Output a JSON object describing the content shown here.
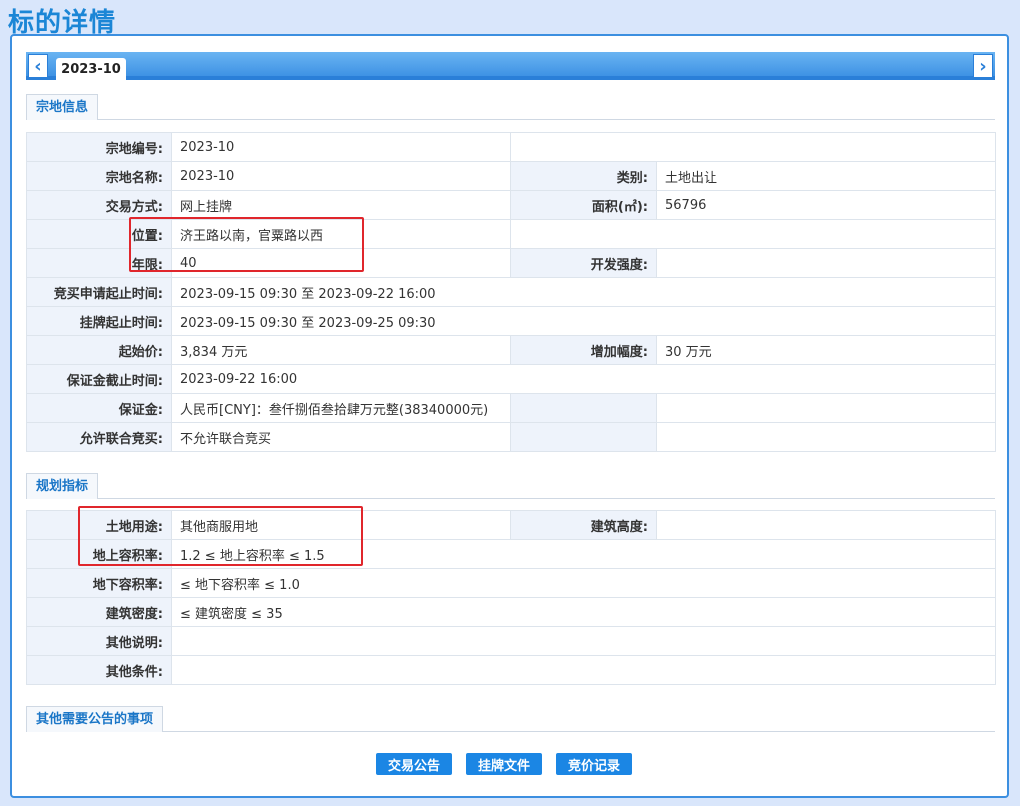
{
  "page_title": "标的详情",
  "tab_label": "2023-10",
  "nav": {
    "prev_symbol": "‹",
    "next_symbol": "›"
  },
  "sections": {
    "land_info": "宗地信息",
    "planning": "规划指标",
    "other_notice": "其他需要公告的事项"
  },
  "land": {
    "parcel_no_label": "宗地编号:",
    "parcel_no": "2023-10",
    "parcel_name_label": "宗地名称:",
    "parcel_name": "2023-10",
    "category_label": "类别:",
    "category": "土地出让",
    "trade_mode_label": "交易方式:",
    "trade_mode": "网上挂牌",
    "area_label": "面积(㎡):",
    "area": "56796",
    "location_label": "位置:",
    "location": "济王路以南，官粟路以西",
    "term_label": "年限:",
    "term": "40",
    "intensity_label": "开发强度:",
    "intensity": "",
    "apply_period_label": "竞买申请起止时间:",
    "apply_period": "2023-09-15 09:30 至 2023-09-22 16:00",
    "listing_period_label": "挂牌起止时间:",
    "listing_period": "2023-09-15 09:30 至 2023-09-25 09:30",
    "start_price_label": "起始价:",
    "start_price": "3,834 万元",
    "increment_label": "增加幅度:",
    "increment": "30 万元",
    "deposit_deadline_label": "保证金截止时间:",
    "deposit_deadline": "2023-09-22 16:00",
    "deposit_label": "保证金:",
    "deposit": "人民币[CNY]：叁仟捌佰叁拾肆万元整(38340000元)",
    "joint_bid_label": "允许联合竞买:",
    "joint_bid": "不允许联合竞买"
  },
  "plan": {
    "land_use_label": "土地用途:",
    "land_use": "其他商服用地",
    "height_label": "建筑高度:",
    "height": "",
    "far_above_label": "地上容积率:",
    "far_above": "1.2 ≤ 地上容积率 ≤ 1.5",
    "far_below_label": "地下容积率:",
    "far_below": "≤ 地下容积率 ≤ 1.0",
    "density_label": "建筑密度:",
    "density": "≤ 建筑密度 ≤ 35",
    "other_desc_label": "其他说明:",
    "other_desc": "",
    "other_cond_label": "其他条件:",
    "other_cond": ""
  },
  "buttons": {
    "announcement": "交易公告",
    "listing_doc": "挂牌文件",
    "bid_record": "竞价记录"
  },
  "colors": {
    "accent": "#1b86e4",
    "highlight": "#e0262c",
    "label_bg": "#eef3fb"
  }
}
